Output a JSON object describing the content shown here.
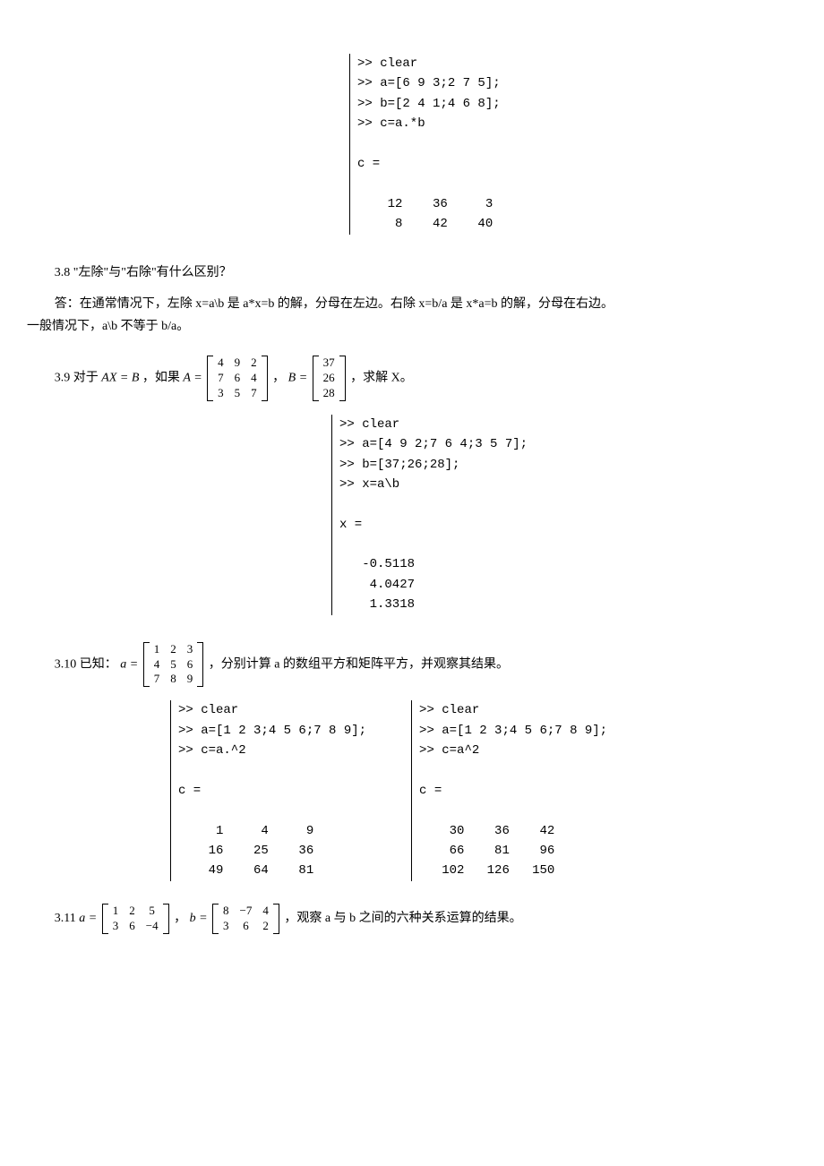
{
  "code1": ">> clear\n>> a=[6 9 3;2 7 5];\n>> b=[2 4 1;4 6 8];\n>> c=a.*b\n\nc =\n\n    12    36     3\n     8    42    40",
  "q38_title": "3.8  \"左除\"与\"右除\"有什么区别？",
  "q38_ans1": "答：在通常情况下，左除 x=a\\b 是 a*x=b 的解，分母在左边。右除 x=b/a 是 x*a=b 的解，分母在右边。",
  "q38_ans2": "一般情况下，a\\b 不等于 b/a。",
  "q39_pre": "3.9  对于",
  "q39_eq1": "AX = B",
  "q39_mid1": "，如果",
  "q39_A_rows": [
    [
      "4",
      "9",
      "2"
    ],
    [
      "7",
      "6",
      "4"
    ],
    [
      "3",
      "5",
      "7"
    ]
  ],
  "q39_mid2": "，",
  "q39_B_rows": [
    [
      "37"
    ],
    [
      "26"
    ],
    [
      "28"
    ]
  ],
  "q39_post": "，求解 X。",
  "code2": ">> clear\n>> a=[4 9 2;7 6 4;3 5 7];\n>> b=[37;26;28];\n>> x=a\\b\n\nx =\n\n   -0.5118\n    4.0427\n    1.3318",
  "q310_pre": "3.10  已知：",
  "q310_a_rows": [
    [
      "1",
      "2",
      "3"
    ],
    [
      "4",
      "5",
      "6"
    ],
    [
      "7",
      "8",
      "9"
    ]
  ],
  "q310_post": "，分别计算 a 的数组平方和矩阵平方，并观察其结果。",
  "code3a": ">> clear\n>> a=[1 2 3;4 5 6;7 8 9];\n>> c=a.^2\n\nc =\n\n     1     4     9\n    16    25    36\n    49    64    81",
  "code3b": ">> clear\n>> a=[1 2 3;4 5 6;7 8 9];\n>> c=a^2\n\nc =\n\n    30    36    42\n    66    81    96\n   102   126   150",
  "q311_pre": "3.11  ",
  "q311_a_rows": [
    [
      "1",
      "2",
      "5"
    ],
    [
      "3",
      "6",
      "−4"
    ]
  ],
  "q311_mid": "，",
  "q311_b_rows": [
    [
      "8",
      "−7",
      "4"
    ],
    [
      "3",
      "6",
      "2"
    ]
  ],
  "q311_post": "，观察 a 与 b 之间的六种关系运算的结果。",
  "labels": {
    "A_eq": "A =",
    "B_eq": "B =",
    "a_eq": "a =",
    "b_eq": "b ="
  }
}
